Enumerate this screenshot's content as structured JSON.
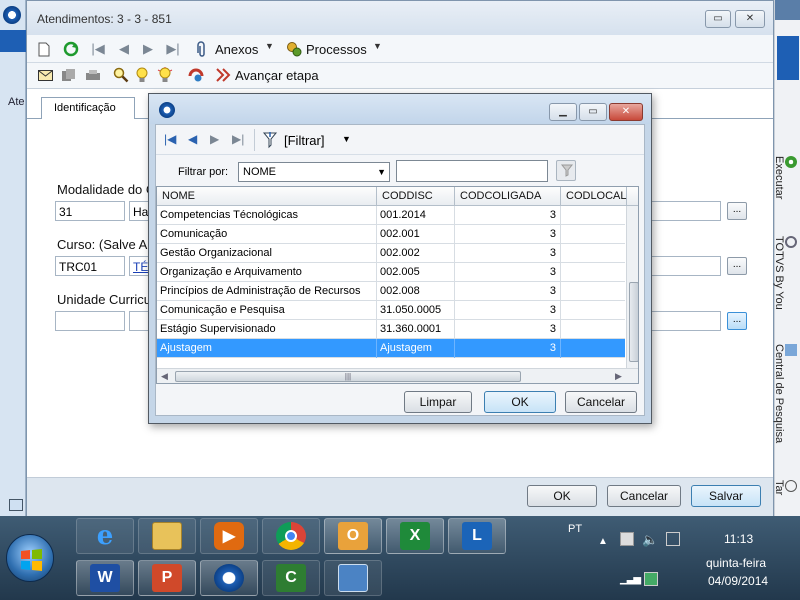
{
  "main_window": {
    "title": "Atendimentos: 3 - 3 - 851",
    "toolbar": {
      "anexos_label": "Anexos",
      "processos_label": "Processos",
      "avancar_label": "Avançar etapa"
    },
    "tab_label": "Identificação",
    "fields": {
      "modalidade_label": "Modalidade do C",
      "modalidade_code": "31",
      "modalidade_desc": "Hab",
      "curso_label": "Curso: (Salve Ant",
      "curso_code": "TRC01",
      "curso_desc": "TÉC",
      "unidade_label": "Unidade Curricul"
    },
    "buttons": {
      "ok": "OK",
      "cancel": "Cancelar",
      "save": "Salvar"
    },
    "left_strip_text": "Ate"
  },
  "right_sidebar": {
    "items": [
      "Executar",
      "TOTVS By You",
      "Central de Pesquisa",
      "Tar"
    ]
  },
  "dialog": {
    "nav": {
      "filter_label": "[Filtrar]"
    },
    "filter_by_label": "Filtrar por:",
    "filter_field": "NOME",
    "filter_value": "",
    "columns": [
      "NOME",
      "CODDISC",
      "CODCOLIGADA",
      "CODLOCAL"
    ],
    "rows": [
      {
        "nome": "Competencias Técnológicas",
        "coddisc": "001.2014",
        "codcoligada": "3",
        "codlocal": "",
        "selected": false
      },
      {
        "nome": "Comunicação",
        "coddisc": "002.001",
        "codcoligada": "3",
        "codlocal": "",
        "selected": false
      },
      {
        "nome": "Gestão Organizacional",
        "coddisc": "002.002",
        "codcoligada": "3",
        "codlocal": "",
        "selected": false
      },
      {
        "nome": "Organização e Arquivamento",
        "coddisc": "002.005",
        "codcoligada": "3",
        "codlocal": "",
        "selected": false
      },
      {
        "nome": "Princípios de Administração de Recursos",
        "coddisc": "002.008",
        "codcoligada": "3",
        "codlocal": "",
        "selected": false
      },
      {
        "nome": "Comunicação e Pesquisa",
        "coddisc": "31.050.0005",
        "codcoligada": "3",
        "codlocal": "",
        "selected": false
      },
      {
        "nome": "Estágio Supervisionado",
        "coddisc": "31.360.0001",
        "codcoligada": "3",
        "codlocal": "",
        "selected": false
      },
      {
        "nome": "Ajustagem",
        "coddisc": "Ajustagem",
        "codcoligada": "3",
        "codlocal": "",
        "selected": true
      }
    ],
    "buttons": {
      "clear": "Limpar",
      "ok": "OK",
      "cancel": "Cancelar"
    }
  },
  "taskbar": {
    "language": "PT",
    "time": "11:13",
    "weekday": "quinta-feira",
    "date": "04/09/2014",
    "apps": [
      "Internet Explorer",
      "File Explorer",
      "Media Player",
      "Chrome",
      "Outlook",
      "Excel",
      "Lync",
      "Word",
      "PowerPoint",
      "TOTVS",
      "Camtasia",
      "Remote Desktop"
    ]
  },
  "colors": {
    "selection": "#3399ff",
    "taskbar": "#2e4a60",
    "link": "#1a3fb5"
  }
}
